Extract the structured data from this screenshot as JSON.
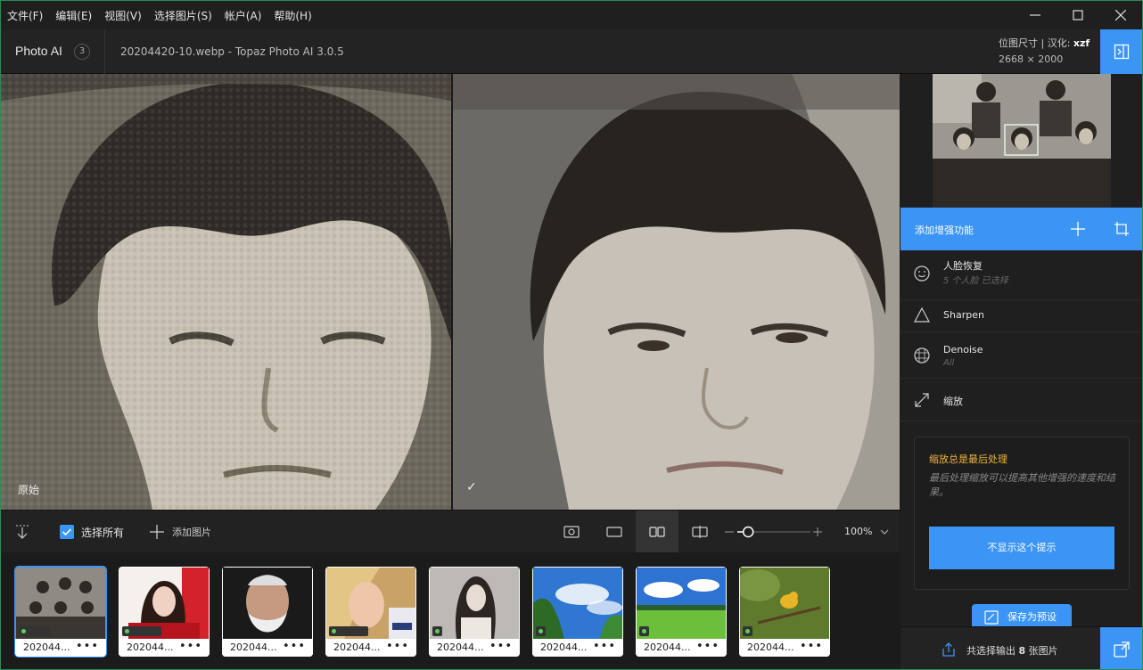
{
  "menu": [
    "文件(F)",
    "编辑(E)",
    "视图(V)",
    "选择图片(S)",
    "帐户(A)",
    "帮助(H)"
  ],
  "header": {
    "app_name": "Photo AI",
    "count": "3",
    "filename": "20204420-10.webp - Topaz Photo AI 3.0.5",
    "dims_label": "位图尺寸 | 汉化:",
    "dims_author": "xzf",
    "dims_value": "2668 × 2000"
  },
  "viewer": {
    "left_label": "原始",
    "right_label": "✓"
  },
  "toolbar": {
    "select_all": "选择所有",
    "add_images": "添加图片",
    "zoom": "100%",
    "zoom_slider": 0.1
  },
  "thumbs": [
    {
      "label": "202044...",
      "more": "•••"
    },
    {
      "label": "202044...",
      "more": "•••"
    },
    {
      "label": "202044...",
      "more": "•••"
    },
    {
      "label": "202044...",
      "more": "•••"
    },
    {
      "label": "202044...",
      "more": "•••"
    },
    {
      "label": "202044...",
      "more": "•••"
    },
    {
      "label": "202044...",
      "more": "•••"
    },
    {
      "label": "202044...",
      "more": "•••"
    }
  ],
  "side": {
    "add_enhance": "添加增强功能",
    "tools": [
      {
        "name": "人脸恢复",
        "sub": "5 个人脸 已选择"
      },
      {
        "name": "Sharpen",
        "sub": ""
      },
      {
        "name": "Denoise",
        "sub": "All"
      },
      {
        "name": "缩放",
        "sub": ""
      }
    ],
    "tip_title": "缩放总是最后处理",
    "tip_body": "最后处理缩放可以提高其他增强的速度和结果。",
    "tip_button": "不显示这个提示",
    "save_preset": "保存为预设",
    "export_prefix": "共选择输出 ",
    "export_count": "8",
    "export_suffix": " 张图片"
  },
  "colors": {
    "accent": "#3b95f5",
    "tip_title": "#f1b43d"
  }
}
